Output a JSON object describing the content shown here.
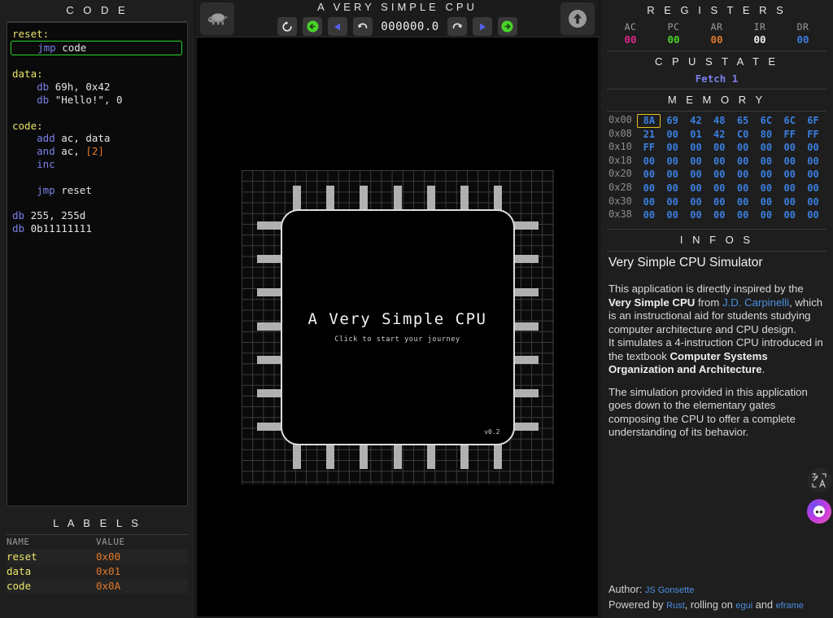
{
  "app": {
    "title": "A VERY SIMPLE CPU",
    "counter": "000000.0"
  },
  "toolbar": {
    "speed_button": "turtle-icon",
    "reset_label": "reset-icon",
    "step_back_fast_label": "back-fast-icon",
    "step_back_label": "step-back-icon",
    "undo_label": "undo-icon",
    "redo_label": "redo-icon",
    "step_forward_label": "step-forward-icon",
    "run_label": "run-fast-icon",
    "upload_label": "upload-icon"
  },
  "code_panel": {
    "title": "C O D E",
    "lines": [
      [
        {
          "t": "reset:",
          "c": "label"
        }
      ],
      [
        {
          "t": "    ",
          "c": "txt"
        },
        {
          "t": "jmp",
          "c": "kw"
        },
        {
          "t": " code",
          "c": "txt"
        }
      ],
      [
        {
          "t": "",
          "c": "txt"
        }
      ],
      [
        {
          "t": "data:",
          "c": "label"
        }
      ],
      [
        {
          "t": "    ",
          "c": "txt"
        },
        {
          "t": "db",
          "c": "kw"
        },
        {
          "t": " 69h, 0x42",
          "c": "txt"
        }
      ],
      [
        {
          "t": "    ",
          "c": "txt"
        },
        {
          "t": "db",
          "c": "kw"
        },
        {
          "t": " \"Hello!\", 0",
          "c": "txt"
        }
      ],
      [
        {
          "t": "",
          "c": "txt"
        }
      ],
      [
        {
          "t": "code:",
          "c": "label"
        }
      ],
      [
        {
          "t": "    ",
          "c": "txt"
        },
        {
          "t": "add",
          "c": "kw"
        },
        {
          "t": " ac, data",
          "c": "txt"
        }
      ],
      [
        {
          "t": "    ",
          "c": "txt"
        },
        {
          "t": "and",
          "c": "kw"
        },
        {
          "t": " ac, ",
          "c": "txt"
        },
        {
          "t": "[2]",
          "c": "num"
        }
      ],
      [
        {
          "t": "    ",
          "c": "txt"
        },
        {
          "t": "inc",
          "c": "kw"
        }
      ],
      [
        {
          "t": "",
          "c": "txt"
        }
      ],
      [
        {
          "t": "    ",
          "c": "txt"
        },
        {
          "t": "jmp",
          "c": "kw"
        },
        {
          "t": " reset",
          "c": "txt"
        }
      ],
      [
        {
          "t": "",
          "c": "txt"
        }
      ],
      [
        {
          "t": "db",
          "c": "kw"
        },
        {
          "t": " 255, 255d",
          "c": "txt"
        }
      ],
      [
        {
          "t": "db",
          "c": "kw"
        },
        {
          "t": " 0b11111111",
          "c": "txt"
        }
      ]
    ],
    "highlight_line_index": 1,
    "highlight_color": "#28d828"
  },
  "labels_panel": {
    "title": "L A B E L S",
    "columns": [
      "NAME",
      "VALUE"
    ],
    "rows": [
      {
        "name": "reset",
        "value": "0x00"
      },
      {
        "name": "data",
        "value": "0x01"
      },
      {
        "name": "code",
        "value": "0x0A"
      }
    ]
  },
  "chip": {
    "title": "A Very Simple CPU",
    "subtitle": "Click to start your journey",
    "version": "v0.2",
    "pins_per_side": 7
  },
  "registers_panel": {
    "title": "R E G I S T E R S",
    "items": [
      {
        "name": "AC",
        "value": "00",
        "color": "#e0268c"
      },
      {
        "name": "PC",
        "value": "00",
        "color": "#4ad42a"
      },
      {
        "name": "AR",
        "value": "00",
        "color": "#e0792a"
      },
      {
        "name": "IR",
        "value": "00",
        "color": "#f0f0f0"
      },
      {
        "name": "DR",
        "value": "00",
        "color": "#3b7fe0"
      }
    ]
  },
  "cpu_state_panel": {
    "title": "C P U   S T A T E",
    "state": "Fetch 1"
  },
  "memory_panel": {
    "title": "M E M O R Y",
    "selected": {
      "row": 0,
      "col": 0
    },
    "rows": [
      {
        "addr": "0x00",
        "cells": [
          "8A",
          "69",
          "42",
          "48",
          "65",
          "6C",
          "6C",
          "6F"
        ]
      },
      {
        "addr": "0x08",
        "cells": [
          "21",
          "00",
          "01",
          "42",
          "C0",
          "80",
          "FF",
          "FF"
        ]
      },
      {
        "addr": "0x10",
        "cells": [
          "FF",
          "00",
          "00",
          "00",
          "00",
          "00",
          "00",
          "00"
        ]
      },
      {
        "addr": "0x18",
        "cells": [
          "00",
          "00",
          "00",
          "00",
          "00",
          "00",
          "00",
          "00"
        ]
      },
      {
        "addr": "0x20",
        "cells": [
          "00",
          "00",
          "00",
          "00",
          "00",
          "00",
          "00",
          "00"
        ]
      },
      {
        "addr": "0x28",
        "cells": [
          "00",
          "00",
          "00",
          "00",
          "00",
          "00",
          "00",
          "00"
        ]
      },
      {
        "addr": "0x30",
        "cells": [
          "00",
          "00",
          "00",
          "00",
          "00",
          "00",
          "00",
          "00"
        ]
      },
      {
        "addr": "0x38",
        "cells": [
          "00",
          "00",
          "00",
          "00",
          "00",
          "00",
          "00",
          "00"
        ]
      }
    ]
  },
  "infos_panel": {
    "title": "I N F O S",
    "heading": "Very Simple CPU Simulator",
    "p1_a": "This application is directly inspired by the ",
    "p1_b": "Very Simple CPU",
    "p1_c": " from ",
    "p1_link": "J.D. Carpinelli",
    "p1_d": ", which is an instructional aid for students studying computer architecture and CPU design.",
    "p2_a": "It simulates a 4-instruction CPU introduced in the textbook ",
    "p2_b": "Computer Systems Organization and Architecture",
    "p2_c": ".",
    "p3": "The simulation provided in this application goes down to the elementary gates composing the CPU to offer a complete understanding of its behavior."
  },
  "footer": {
    "author_label": "Author: ",
    "author_name": "JS Gonsette",
    "powered_a": "Powered by ",
    "powered_rust": "Rust",
    "powered_b": ", rolling on ",
    "powered_egui": "egui",
    "powered_c": " and ",
    "powered_eframe": "eframe"
  },
  "floating": {
    "translate": "translate-icon",
    "extension": "extension-icon"
  }
}
